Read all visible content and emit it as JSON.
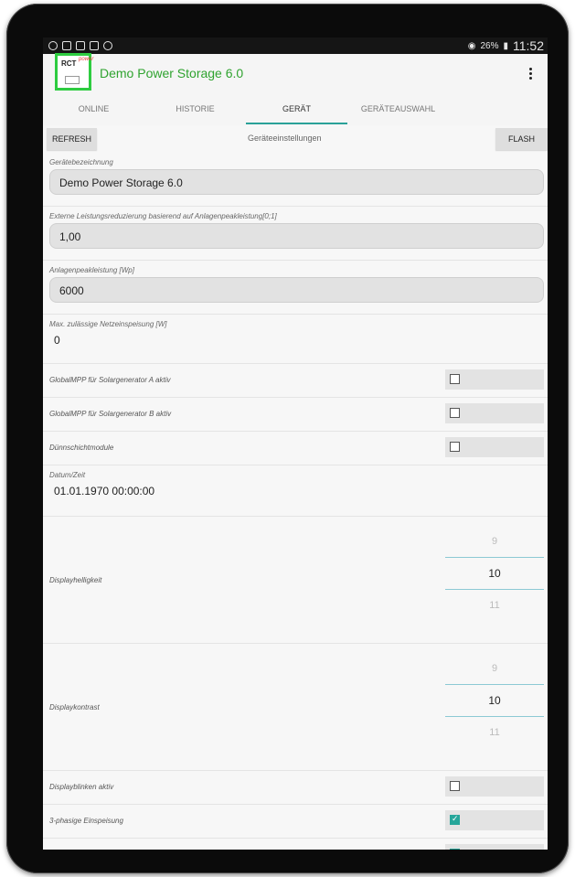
{
  "status_bar": {
    "battery": "26%",
    "time": "11:52"
  },
  "app": {
    "title": "Demo Power Storage 6.0",
    "logo_text": "RCT",
    "logo_accent": "power"
  },
  "tabs": [
    {
      "label": "ONLINE"
    },
    {
      "label": "HISTORIE"
    },
    {
      "label": "GERÄT"
    },
    {
      "label": "GERÄTEAUSWAHL"
    }
  ],
  "toolbar": {
    "refresh_label": "REFRESH",
    "title": "Geräteeinstellungen",
    "flash_label": "FLASH"
  },
  "fields": [
    {
      "label": "Gerätebezeichnung",
      "value": "Demo Power Storage 6.0"
    },
    {
      "label": "Externe Leistungsreduzierung basierend auf Anlagenpeakleistung[0;1]",
      "value": "1,00"
    },
    {
      "label": "Anlagenpeakleistung [Wp]",
      "value": "6000"
    },
    {
      "label": "Max. zulässige Netzeinspeisung [W]",
      "value": "0"
    }
  ],
  "checkboxes": [
    {
      "label": "GlobalMPP für Solargenerator A aktiv",
      "checked": false
    },
    {
      "label": "GlobalMPP für Solargenerator B aktiv",
      "checked": false
    },
    {
      "label": "Dünnschichtmodule",
      "checked": false
    }
  ],
  "datetime": {
    "label": "Datum/Zeit",
    "value": "01.01.1970 00:00:00"
  },
  "pickers": [
    {
      "label": "Displayhelligkeit",
      "prev": "9",
      "value": "10",
      "next": "11"
    },
    {
      "label": "Displaykontrast",
      "prev": "9",
      "value": "10",
      "next": "11"
    }
  ],
  "checkboxes2": [
    {
      "label": "Displayblinken aktiv",
      "checked": false
    },
    {
      "label": "3-phasige Einspeisung",
      "checked": true
    }
  ],
  "colors": {
    "accent": "#2fa32f",
    "tab_indicator": "#2aa198",
    "check": "#26a69a"
  }
}
